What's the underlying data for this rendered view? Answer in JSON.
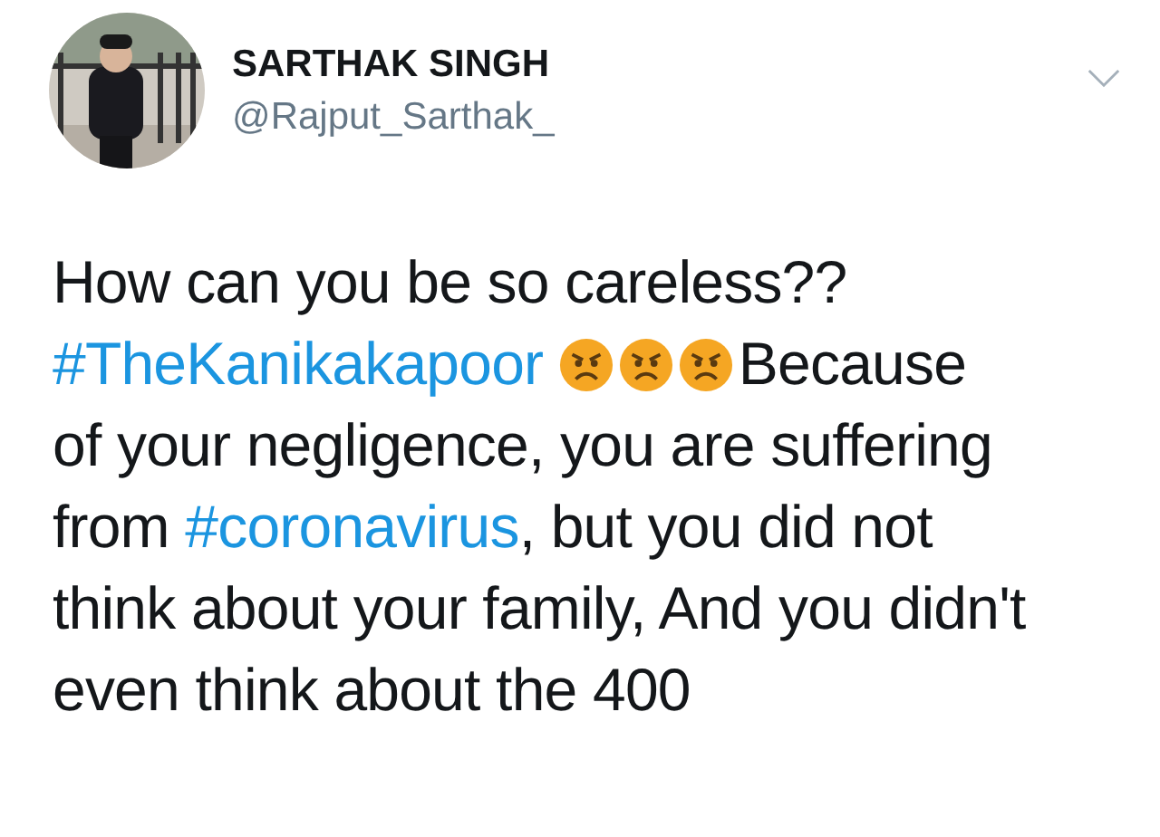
{
  "author": {
    "name": "SARTHAK SINGH",
    "handle": "@Rajput_Sarthak_"
  },
  "body": {
    "lines": [
      [
        {
          "kind": "text",
          "text": "How can you be so careless??"
        }
      ],
      [
        {
          "kind": "hashtag",
          "text": "#TheKanikakapoor"
        },
        {
          "kind": "space"
        },
        {
          "kind": "emoji"
        },
        {
          "kind": "emoji"
        },
        {
          "kind": "emoji"
        },
        {
          "kind": "text",
          "text": "Because"
        }
      ],
      [
        {
          "kind": "text",
          "text": "of your negligence, you are suffering"
        }
      ],
      [
        {
          "kind": "text",
          "text": "from "
        },
        {
          "kind": "hashtag",
          "text": "#coronavirus"
        },
        {
          "kind": "text",
          "text": ", but you did not"
        }
      ],
      [
        {
          "kind": "text",
          "text": "think about your family, And you didn't"
        }
      ],
      [
        {
          "kind": "text",
          "text": "even think about the 400"
        }
      ]
    ]
  }
}
